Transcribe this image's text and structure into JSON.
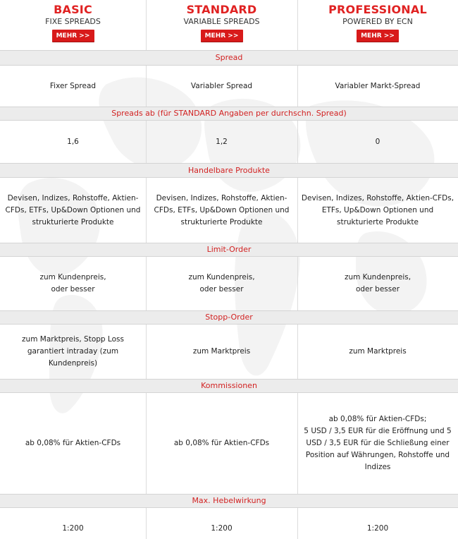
{
  "plans": [
    {
      "name": "BASIC",
      "subtitle": "FIXE SPREADS",
      "button": "MEHR >>"
    },
    {
      "name": "STANDARD",
      "subtitle": "VARIABLE SPREADS",
      "button": "MEHR >>"
    },
    {
      "name": "PROFESSIONAL",
      "subtitle": "POWERED BY ECN",
      "button": "MEHR >>"
    }
  ],
  "sections": [
    {
      "title": "Spread",
      "values": [
        "Fixer Spread",
        "Variabler Spread",
        "Variabler Markt-Spread"
      ]
    },
    {
      "title": "Spreads ab (für STANDARD Angaben per durchschn. Spread)",
      "values": [
        "1,6",
        "1,2",
        "0"
      ]
    },
    {
      "title": "Handelbare Produkte",
      "values": [
        "Devisen, Indizes, Rohstoffe, Aktien-CFDs, ETFs, Up&Down Optionen und strukturierte Produkte",
        "Devisen, Indizes, Rohstoffe, Aktien-CFDs, ETFs, Up&Down Optionen und strukturierte Produkte",
        "Devisen, Indizes, Rohstoffe, Aktien-CFDs, ETFs, Up&Down Optionen und strukturierte Produkte"
      ]
    },
    {
      "title": "Limit-Order",
      "values": [
        "zum Kundenpreis,\noder besser",
        "zum Kundenpreis,\noder besser",
        "zum Kundenpreis,\noder besser"
      ]
    },
    {
      "title": "Stopp-Order",
      "values": [
        "zum Marktpreis, Stopp Loss garantiert intraday (zum Kundenpreis)",
        "zum Marktpreis",
        "zum Marktpreis"
      ]
    },
    {
      "title": "Kommissionen",
      "values": [
        "ab 0,08% für Aktien-CFDs",
        "ab 0,08% für Aktien-CFDs",
        "ab 0,08% für Aktien-CFDs;\n5 USD / 3,5 EUR für die Eröffnung und 5 USD / 3,5 EUR für die Schließung einer Position auf Währungen, Rohstoffe und Indizes"
      ]
    },
    {
      "title": "Max. Hebelwirkung",
      "values": [
        "1:200",
        "1:200",
        "1:200"
      ]
    }
  ],
  "colors": {
    "accent": "#e02222",
    "button": "#d81a1a",
    "section_bg": "#ececec"
  }
}
